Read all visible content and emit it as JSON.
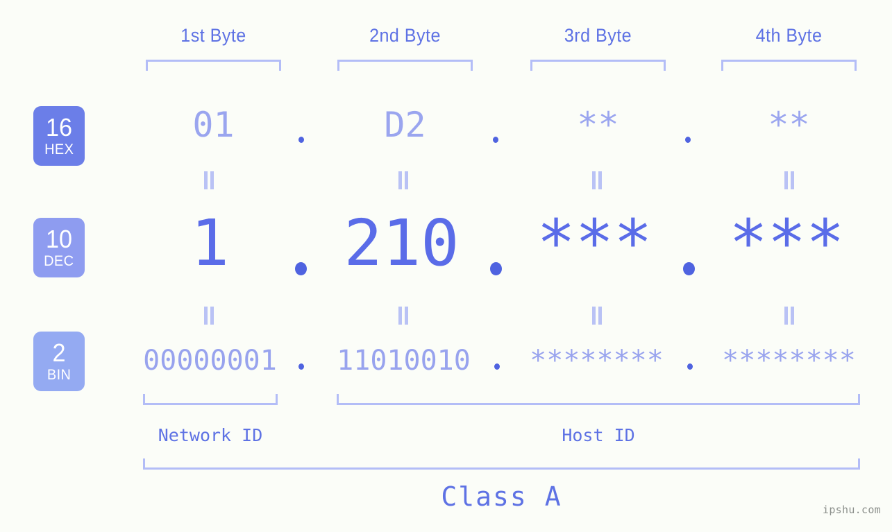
{
  "colors": {
    "background": "#fbfdf8",
    "accent_strong": "#4f63e0",
    "accent_mid": "#5a6ce8",
    "accent_light": "#9aa5ef",
    "bracket": "#b3bdf7",
    "badge_hex": "#6b7ee8",
    "badge_dec": "#8e9cf0",
    "badge_bin": "#94aaf2",
    "header_text": "#5e72e4",
    "watermark": "#8b8f8b"
  },
  "byte_headers": [
    {
      "label": "1st Byte"
    },
    {
      "label": "2nd Byte"
    },
    {
      "label": "3rd Byte"
    },
    {
      "label": "4th Byte"
    }
  ],
  "rows": [
    {
      "base_number": "16",
      "base_abbr": "HEX",
      "values": [
        "01",
        "D2",
        "**",
        "**"
      ],
      "separator": "."
    },
    {
      "base_number": "10",
      "base_abbr": "DEC",
      "values": [
        "1",
        "210",
        "***",
        "***"
      ],
      "separator": "."
    },
    {
      "base_number": "2",
      "base_abbr": "BIN",
      "values": [
        "00000001",
        "11010010",
        "********",
        "********"
      ],
      "separator": "."
    }
  ],
  "equality_mark": "=",
  "sections": [
    {
      "label": "Network ID"
    },
    {
      "label": "Host ID"
    }
  ],
  "class_label": "Class A",
  "watermark": "ipshu.com"
}
